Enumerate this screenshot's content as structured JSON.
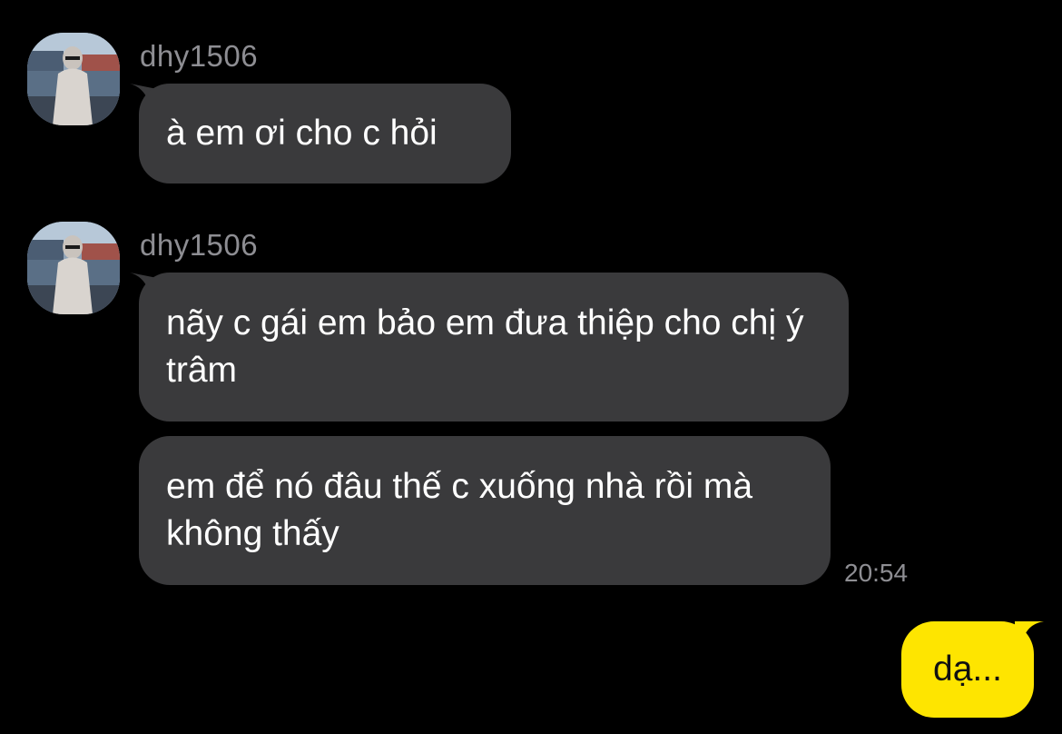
{
  "colors": {
    "background": "#000000",
    "incoming_bubble": "#3a3a3c",
    "outgoing_bubble": "#fee500",
    "meta_text": "#8e8e93"
  },
  "groups": [
    {
      "sender": "dhy1506",
      "avatar_icon": "profile-photo",
      "messages": [
        "à em ơi cho c hỏi"
      ]
    },
    {
      "sender": "dhy1506",
      "avatar_icon": "profile-photo",
      "messages": [
        "nãy c gái em bảo em đưa thiệp cho chị ý trâm",
        "em để nó đâu thế c xuống nhà rồi mà không thấy"
      ],
      "time": "20:54"
    }
  ],
  "outgoing": {
    "text": "dạ..."
  }
}
